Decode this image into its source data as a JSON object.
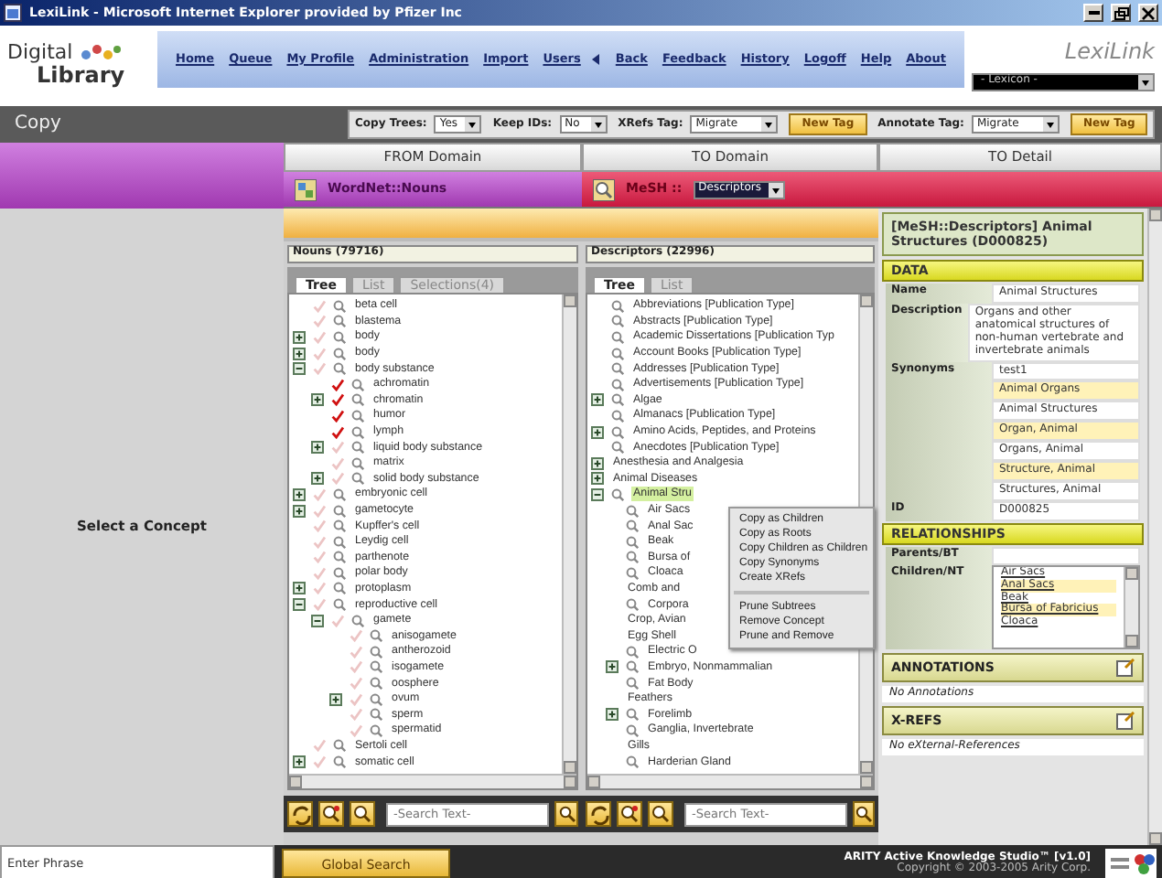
{
  "window": {
    "title": "LexiLink - Microsoft Internet Explorer provided by Pfizer Inc"
  },
  "header": {
    "logo_top": "Digital",
    "logo_bottom": "Library",
    "nav_left": [
      "Home",
      "Queue",
      "My Profile",
      "Administration",
      "Import",
      "Users"
    ],
    "nav_right": [
      "Back",
      "Feedback",
      "History",
      "Logoff",
      "Help",
      "About"
    ],
    "app_name": "LexiLink",
    "lexicon_select": "- Lexicon -"
  },
  "toolbar": {
    "title": "Copy",
    "controls": [
      {
        "kind": "select",
        "label": "Copy Trees:",
        "value": "Yes"
      },
      {
        "kind": "select",
        "label": "Keep IDs:",
        "value": "No"
      },
      {
        "kind": "select",
        "label": "XRefs Tag:",
        "value": "Migrate"
      },
      {
        "kind": "button",
        "label": "New Tag"
      },
      {
        "kind": "select",
        "label": "Annotate Tag:",
        "value": "Migrate"
      },
      {
        "kind": "button",
        "label": "New Tag"
      }
    ]
  },
  "columns": [
    "FROM Domain",
    "TO Domain",
    "TO Detail"
  ],
  "left_pane": {
    "message": "Select a Concept"
  },
  "from_panel": {
    "title": "WordNet::Nouns",
    "count": "Nouns (79716)",
    "tabs": [
      {
        "label": "Tree",
        "selected": true
      },
      {
        "label": "List",
        "selected": false
      },
      {
        "label": "Selections(4)",
        "selected": false
      }
    ],
    "search_placeholder": "-Search Text-",
    "tree": [
      {
        "label": "beta cell",
        "checked": false
      },
      {
        "label": "blastema",
        "checked": false
      },
      {
        "label": "body",
        "checked": false,
        "expanded": false
      },
      {
        "label": "body",
        "checked": false,
        "expanded": false
      },
      {
        "label": "body substance",
        "checked": false,
        "expanded": true,
        "children": [
          {
            "label": "achromatin",
            "checked": true
          },
          {
            "label": "chromatin",
            "checked": true,
            "expanded": false
          },
          {
            "label": "humor",
            "checked": true
          },
          {
            "label": "lymph",
            "checked": true
          },
          {
            "label": "liquid body substance",
            "checked": false,
            "expanded": false
          },
          {
            "label": "matrix",
            "checked": false
          },
          {
            "label": "solid body substance",
            "checked": false,
            "expanded": false
          }
        ]
      },
      {
        "label": "embryonic cell",
        "checked": false,
        "expanded": false
      },
      {
        "label": "gametocyte",
        "checked": false,
        "expanded": false
      },
      {
        "label": "Kupffer's cell",
        "checked": false
      },
      {
        "label": "Leydig cell",
        "checked": false
      },
      {
        "label": "parthenote",
        "checked": false
      },
      {
        "label": "polar body",
        "checked": false
      },
      {
        "label": "protoplasm",
        "checked": false,
        "expanded": false
      },
      {
        "label": "reproductive cell",
        "checked": false,
        "expanded": true,
        "children": [
          {
            "label": "gamete",
            "checked": false,
            "expanded": true,
            "children": [
              {
                "label": "anisogamete",
                "checked": false
              },
              {
                "label": "antherozoid",
                "checked": false
              },
              {
                "label": "isogamete",
                "checked": false
              },
              {
                "label": "oosphere",
                "checked": false
              },
              {
                "label": "ovum",
                "checked": false,
                "expanded": false
              },
              {
                "label": "sperm",
                "checked": false
              },
              {
                "label": "spermatid",
                "checked": false
              }
            ]
          }
        ]
      },
      {
        "label": "Sertoli cell",
        "checked": false
      },
      {
        "label": "somatic cell",
        "checked": false,
        "expanded": false
      }
    ]
  },
  "to_panel": {
    "title": "MeSH ::",
    "scheme_select": "Descriptors",
    "count": "Descriptors (22996)",
    "tabs": [
      {
        "label": "Tree",
        "selected": true
      },
      {
        "label": "List",
        "selected": false
      }
    ],
    "search_placeholder": "-Search Text-",
    "tree": [
      {
        "label": "Abbreviations [Publication Type]",
        "lens": true,
        "selected": false
      },
      {
        "label": "Abstracts [Publication Type]",
        "lens": true,
        "selected": false
      },
      {
        "label": "Academic Dissertations [Publication Typ",
        "lens": true,
        "selected": false
      },
      {
        "label": "Account Books [Publication Type]",
        "lens": true,
        "selected": false
      },
      {
        "label": "Addresses [Publication Type]",
        "lens": true,
        "selected": false
      },
      {
        "label": "Advertisements [Publication Type]",
        "lens": true,
        "selected": false
      },
      {
        "label": "Algae",
        "lens": true,
        "selected": false,
        "expanded": false
      },
      {
        "label": "Almanacs [Publication Type]",
        "lens": true,
        "selected": false
      },
      {
        "label": "Amino Acids, Peptides, and Proteins",
        "lens": true,
        "selected": false,
        "expanded": false
      },
      {
        "label": "Anecdotes [Publication Type]",
        "lens": true,
        "selected": false
      },
      {
        "label": "Anesthesia and Analgesia",
        "lens": false,
        "selected": false,
        "expanded": false
      },
      {
        "label": "Animal Diseases",
        "lens": false,
        "selected": false,
        "expanded": false
      },
      {
        "label": "Animal Stru",
        "lens": true,
        "selected": true,
        "expanded": true,
        "children": [
          {
            "label": "Air Sacs",
            "lens": true,
            "selected": false
          },
          {
            "label": "Anal Sac",
            "lens": true,
            "selected": false
          },
          {
            "label": "Beak",
            "lens": true,
            "selected": false
          },
          {
            "label": "Bursa of",
            "lens": true,
            "selected": false
          },
          {
            "label": "Cloaca",
            "lens": true,
            "selected": false
          },
          {
            "label": "Comb and",
            "lens": false,
            "selected": false
          },
          {
            "label": "Corpora",
            "lens": true,
            "selected": false
          },
          {
            "label": "Crop, Avian",
            "lens": false,
            "selected": false
          },
          {
            "label": "Egg Shell",
            "lens": false,
            "selected": false
          },
          {
            "label": "Electric O",
            "lens": true,
            "selected": false
          },
          {
            "label": "Embryo, Nonmammalian",
            "lens": true,
            "selected": false,
            "expanded": false
          },
          {
            "label": "Fat Body",
            "lens": true,
            "selected": false
          },
          {
            "label": "Feathers",
            "lens": false,
            "selected": false
          },
          {
            "label": "Forelimb",
            "lens": true,
            "selected": false,
            "expanded": false
          },
          {
            "label": "Ganglia, Invertebrate",
            "lens": true,
            "selected": false
          },
          {
            "label": "Gills",
            "lens": false,
            "selected": false
          },
          {
            "label": "Harderian Gland",
            "lens": true,
            "selected": false
          }
        ]
      }
    ]
  },
  "context_menu": {
    "groups": [
      [
        "Copy as Children",
        "Copy as Roots",
        "Copy Children as Children",
        "Copy Synonyms",
        "Create XRefs"
      ],
      [
        "Prune Subtrees",
        "Remove Concept",
        "Prune and Remove"
      ]
    ]
  },
  "detail": {
    "title": "[MeSH::Descriptors] Animal Structures (D000825)",
    "sections": [
      {
        "kind": "table",
        "heading": "DATA",
        "rows": [
          {
            "label": "Name",
            "kind": "text",
            "values": [
              "Animal Structures"
            ]
          },
          {
            "label": "Description",
            "kind": "text",
            "values": [
              "Organs and other anatomical structures of non-human vertebrate and invertebrate animals"
            ]
          },
          {
            "label": "Synonyms",
            "kind": "list",
            "values": [
              "test1",
              "Animal Organs",
              "Animal Structures",
              "Organ, Animal",
              "Organs, Animal",
              "Structure, Animal",
              "Structures, Animal"
            ]
          },
          {
            "label": "ID",
            "kind": "text",
            "values": [
              "D000825"
            ]
          }
        ]
      },
      {
        "kind": "table",
        "heading": "RELATIONSHIPS",
        "rows": [
          {
            "label": "Parents/BT",
            "kind": "text"
          },
          {
            "label": "Children/NT",
            "kind": "links",
            "values": [
              "Air Sacs",
              "Anal Sacs",
              "Beak",
              "Bursa of Fabricius",
              "Cloaca"
            ]
          }
        ]
      },
      {
        "kind": "notes",
        "heading": "ANNOTATIONS",
        "note": "No Annotations"
      },
      {
        "kind": "notes",
        "heading": "X-REFS",
        "note": "No eXternal-References"
      }
    ]
  },
  "footer": {
    "phrase_value": "Enter Phrase",
    "search_button": "Global Search",
    "product": "ARITY Active Knowledge Studio™ [v1.0]",
    "copyright": "Copyright © 2003-2005 Arity Corp."
  }
}
